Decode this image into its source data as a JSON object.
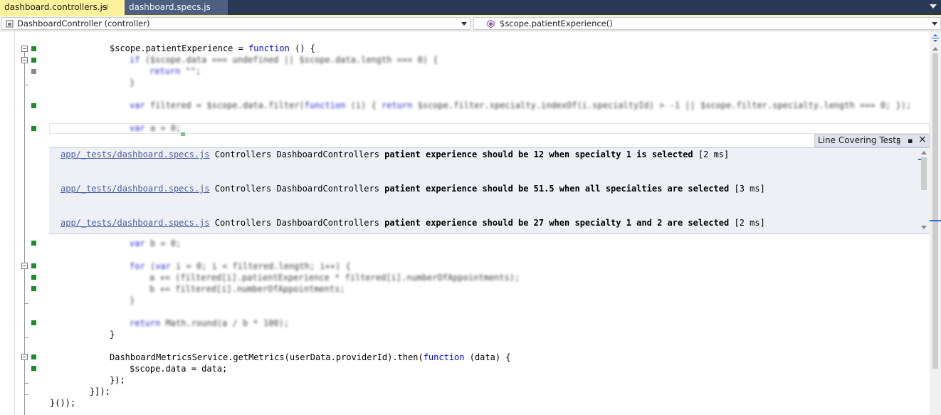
{
  "tabs": [
    {
      "label": "dashboard.controllers.js",
      "active": true
    },
    {
      "label": "dashboard.specs.js",
      "active": false
    }
  ],
  "tab_pin_icon": "pin-icon",
  "tab_close_icon": "close-icon",
  "nav": {
    "left": "DashboardController (controller)",
    "right": "$scope.patientExperience()"
  },
  "code": {
    "line1_a": "$scope.patientExperience = ",
    "line1_kw": "function",
    "line1_b": " () {",
    "close_brace": "}",
    "metrics_a": "DashboardMetricsService.getMetrics(userData.providerId).then(",
    "metrics_kw": "function",
    "metrics_b": " (data) {",
    "assign": "$scope.data = data;",
    "close_paren": "});",
    "close_array": "}]);",
    "close_iife": "}());"
  },
  "line_covering_tests": {
    "title": "Line Covering Tests",
    "rows": [
      {
        "file": "app/_tests/dashboard.specs.js",
        "suite": "Controllers DashboardControllers",
        "name": "patient experience should be 12 when specialty 1 is selected",
        "time": "[2 ms]"
      },
      {
        "file": "app/_tests/dashboard.specs.js",
        "suite": "Controllers DashboardControllers",
        "name": "patient experience should be 51.5 when all specialties are selected",
        "time": "[3 ms]"
      },
      {
        "file": "app/_tests/dashboard.specs.js",
        "suite": "Controllers DashboardControllers",
        "name": "patient experience should be 27 when specialty 1 and 2 are selected",
        "time": "[2 ms]"
      }
    ]
  },
  "colors": {
    "covered": "#1e8c2a",
    "keyword": "#0000ff",
    "active_tab": "#fff29d",
    "tabbar": "#293955"
  }
}
